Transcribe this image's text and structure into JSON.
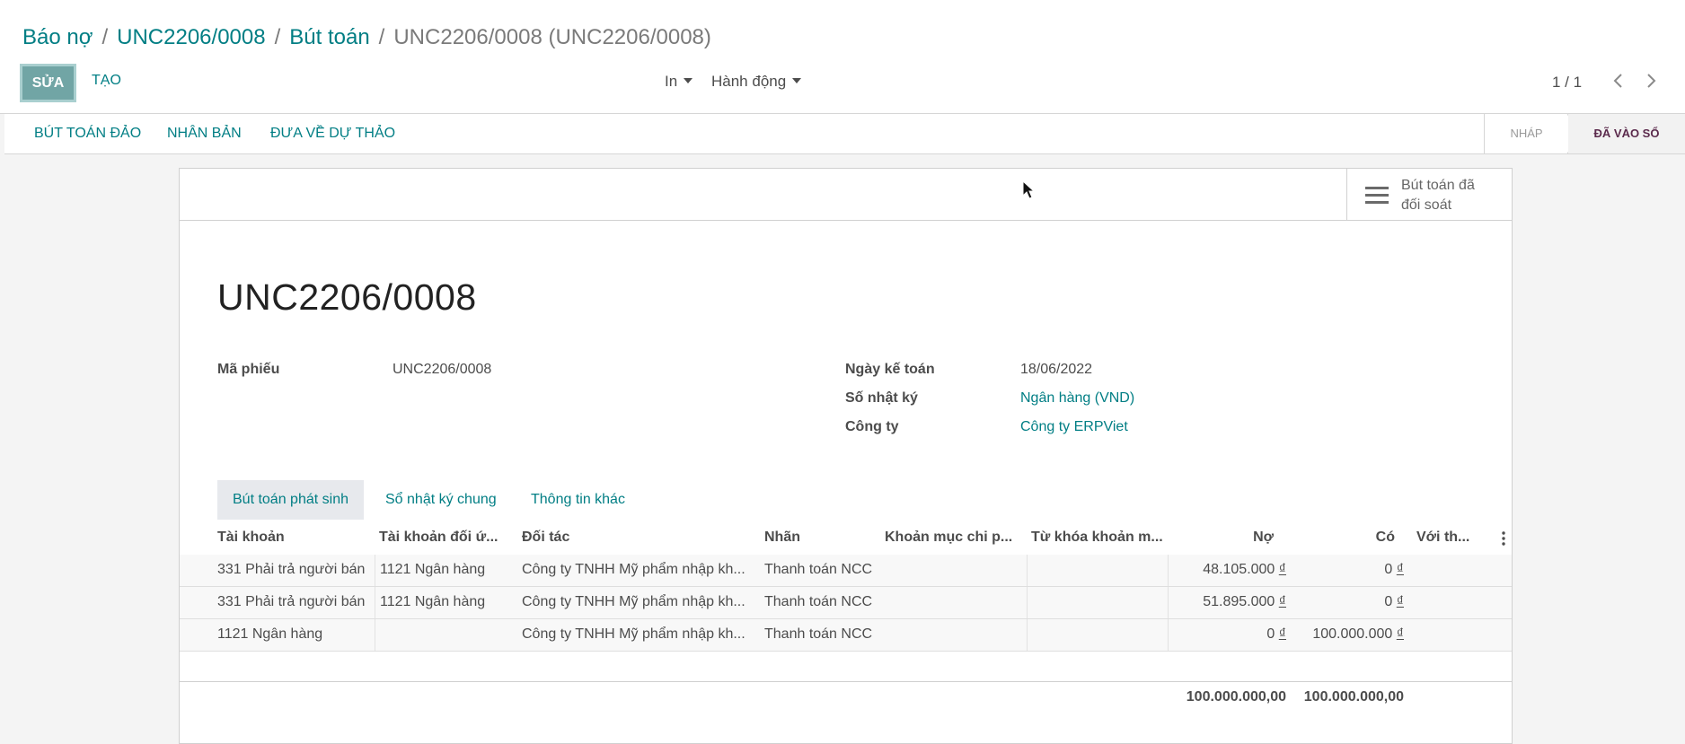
{
  "breadcrumb": {
    "items": [
      "Báo nợ",
      "UNC2206/0008",
      "Bút toán"
    ],
    "current": "UNC2206/0008 (UNC2206/0008)",
    "separator": "/"
  },
  "toolbar": {
    "edit_label": "SỬA",
    "create_label": "TẠO",
    "print_label": "In",
    "action_label": "Hành động",
    "pager_value": "1 / 1"
  },
  "actions": {
    "reverse_label": "BÚT TOÁN ĐẢO",
    "duplicate_label": "NHÂN BẢN",
    "reset_label": "ĐƯA VỀ DỰ THẢO"
  },
  "statusbar": {
    "draft_label": "NHÁP",
    "posted_label": "ĐÃ VÀO SỔ",
    "current": "posted"
  },
  "smart_button": {
    "icon": "list-icon",
    "line1": "Bút toán đã",
    "line2": "đối soát"
  },
  "form": {
    "title": "UNC2206/0008",
    "ref_label": "Mã phiếu",
    "ref_value": "UNC2206/0008",
    "date_label": "Ngày kế toán",
    "date_value": "18/06/2022",
    "journal_label": "Số nhật ký",
    "journal_value": "Ngân hàng (VND)",
    "company_label": "Công ty",
    "company_value": "Công ty ERPViet"
  },
  "tabs": [
    "Bút toán phát sinh",
    "Sổ nhật ký chung",
    "Thông tin khác"
  ],
  "table": {
    "headers": [
      "Tài khoản",
      "Tài khoản đối ứ...",
      "Đối tác",
      "Nhãn",
      "Khoản mục chi p...",
      "Từ khóa khoản m...",
      "Nợ",
      "Có",
      "Với th..."
    ],
    "rows": [
      {
        "account": "331 Phải trả người bán",
        "counter": "1121 Ngân hàng",
        "partner": "Công ty TNHH Mỹ phẩm nhập kh...",
        "label": "Thanh toán NCC",
        "debit": "48.105.000",
        "credit": "0",
        "currency": "₫"
      },
      {
        "account": "331 Phải trả người bán",
        "counter": "1121 Ngân hàng",
        "partner": "Công ty TNHH Mỹ phẩm nhập kh...",
        "label": "Thanh toán NCC",
        "debit": "51.895.000",
        "credit": "0",
        "currency": "₫"
      },
      {
        "account": "1121 Ngân hàng",
        "counter": "",
        "partner": "Công ty TNHH Mỹ phẩm nhập kh...",
        "label": "Thanh toán NCC",
        "debit": "0",
        "credit": "100.000.000",
        "currency": "₫"
      }
    ],
    "total_debit": "100.000.000,00",
    "total_credit": "100.000.000,00"
  },
  "colors": {
    "link": "#017e84",
    "edit_button": "#71a5a5",
    "status_active": "#5b2a4c"
  }
}
